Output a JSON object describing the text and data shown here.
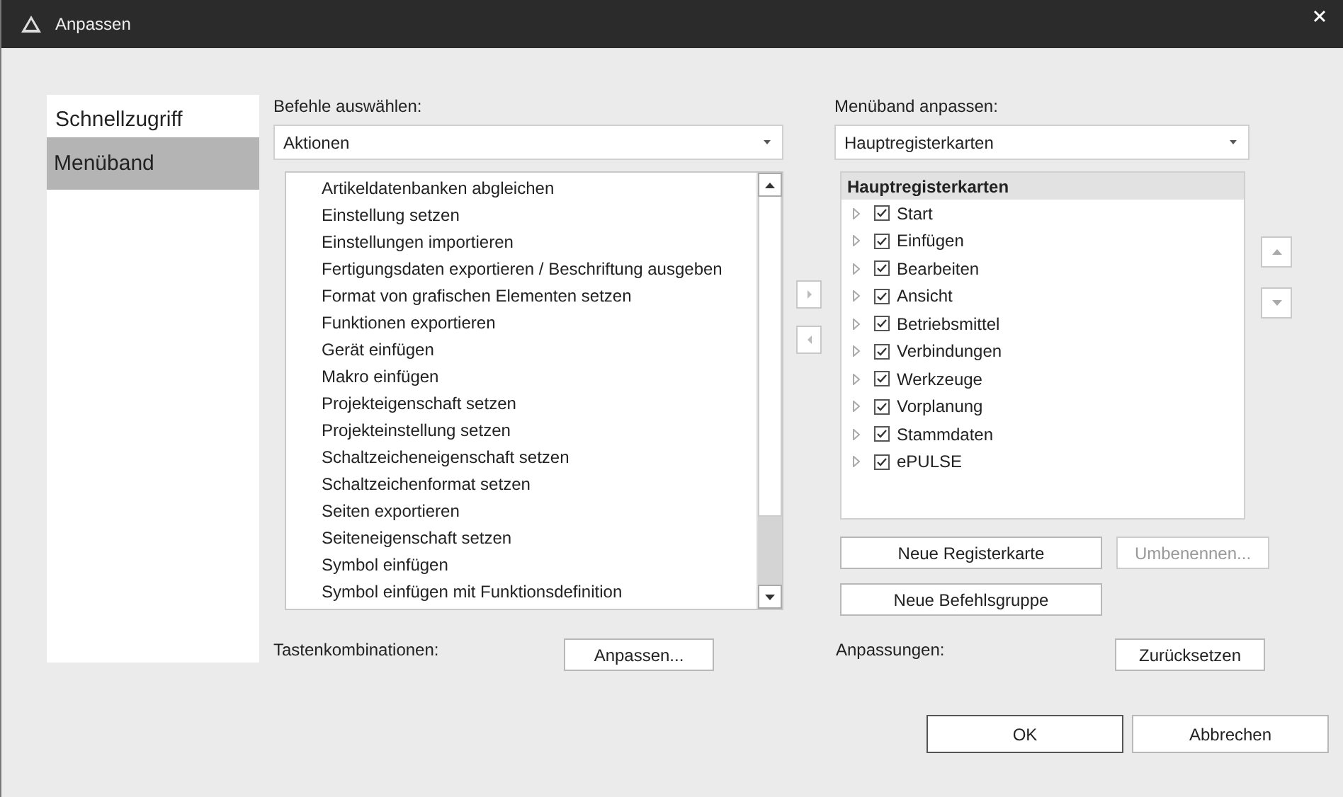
{
  "window": {
    "title": "Anpassen"
  },
  "sidebar": {
    "items": [
      {
        "label": "Schnellzugriff",
        "selected": false
      },
      {
        "label": "Menüband",
        "selected": true
      }
    ]
  },
  "commands": {
    "label": "Befehle auswählen:",
    "dropdown": "Aktionen",
    "items": [
      "Artikeldatenbanken abgleichen",
      "Einstellung setzen",
      "Einstellungen importieren",
      "Fertigungsdaten exportieren / Beschriftung ausgeben",
      "Format von grafischen Elementen setzen",
      "Funktionen exportieren",
      "Gerät einfügen",
      "Makro einfügen",
      "Projekteigenschaft setzen",
      "Projekteinstellung setzen",
      "Schaltzeicheneigenschaft setzen",
      "Schaltzeichenformat setzen",
      "Seiten exportieren",
      "Seiteneigenschaft setzen",
      "Symbol einfügen",
      "Symbol einfügen mit Funktionsdefinition"
    ]
  },
  "ribbon": {
    "label": "Menüband anpassen:",
    "dropdown": "Hauptregisterkarten",
    "tree_header": "Hauptregisterkarten",
    "tabs": [
      {
        "label": "Start",
        "checked": true,
        "expanded": false
      },
      {
        "label": "Einfügen",
        "checked": true,
        "expanded": false
      },
      {
        "label": "Bearbeiten",
        "checked": true,
        "expanded": false
      },
      {
        "label": "Ansicht",
        "checked": true,
        "expanded": false
      },
      {
        "label": "Betriebsmittel",
        "checked": true,
        "expanded": false
      },
      {
        "label": "Verbindungen",
        "checked": true,
        "expanded": false
      },
      {
        "label": "Werkzeuge",
        "checked": true,
        "expanded": false
      },
      {
        "label": "Vorplanung",
        "checked": true,
        "expanded": false
      },
      {
        "label": "Stammdaten",
        "checked": true,
        "expanded": false
      },
      {
        "label": "ePULSE",
        "checked": true,
        "expanded": false
      }
    ],
    "buttons": [
      {
        "label": "Neue Registerkarte",
        "disabled": false
      },
      {
        "label": "Umbenennen...",
        "disabled": true
      },
      {
        "label": "Neue Befehlsgruppe",
        "disabled": false
      }
    ]
  },
  "shortcuts": {
    "label": "Tastenkombinationen:",
    "button": "Anpassen..."
  },
  "customizations": {
    "label": "Anpassungen:",
    "button": "Zurücksetzen"
  },
  "footer": {
    "buttons": [
      "OK",
      "Abbrechen"
    ]
  }
}
